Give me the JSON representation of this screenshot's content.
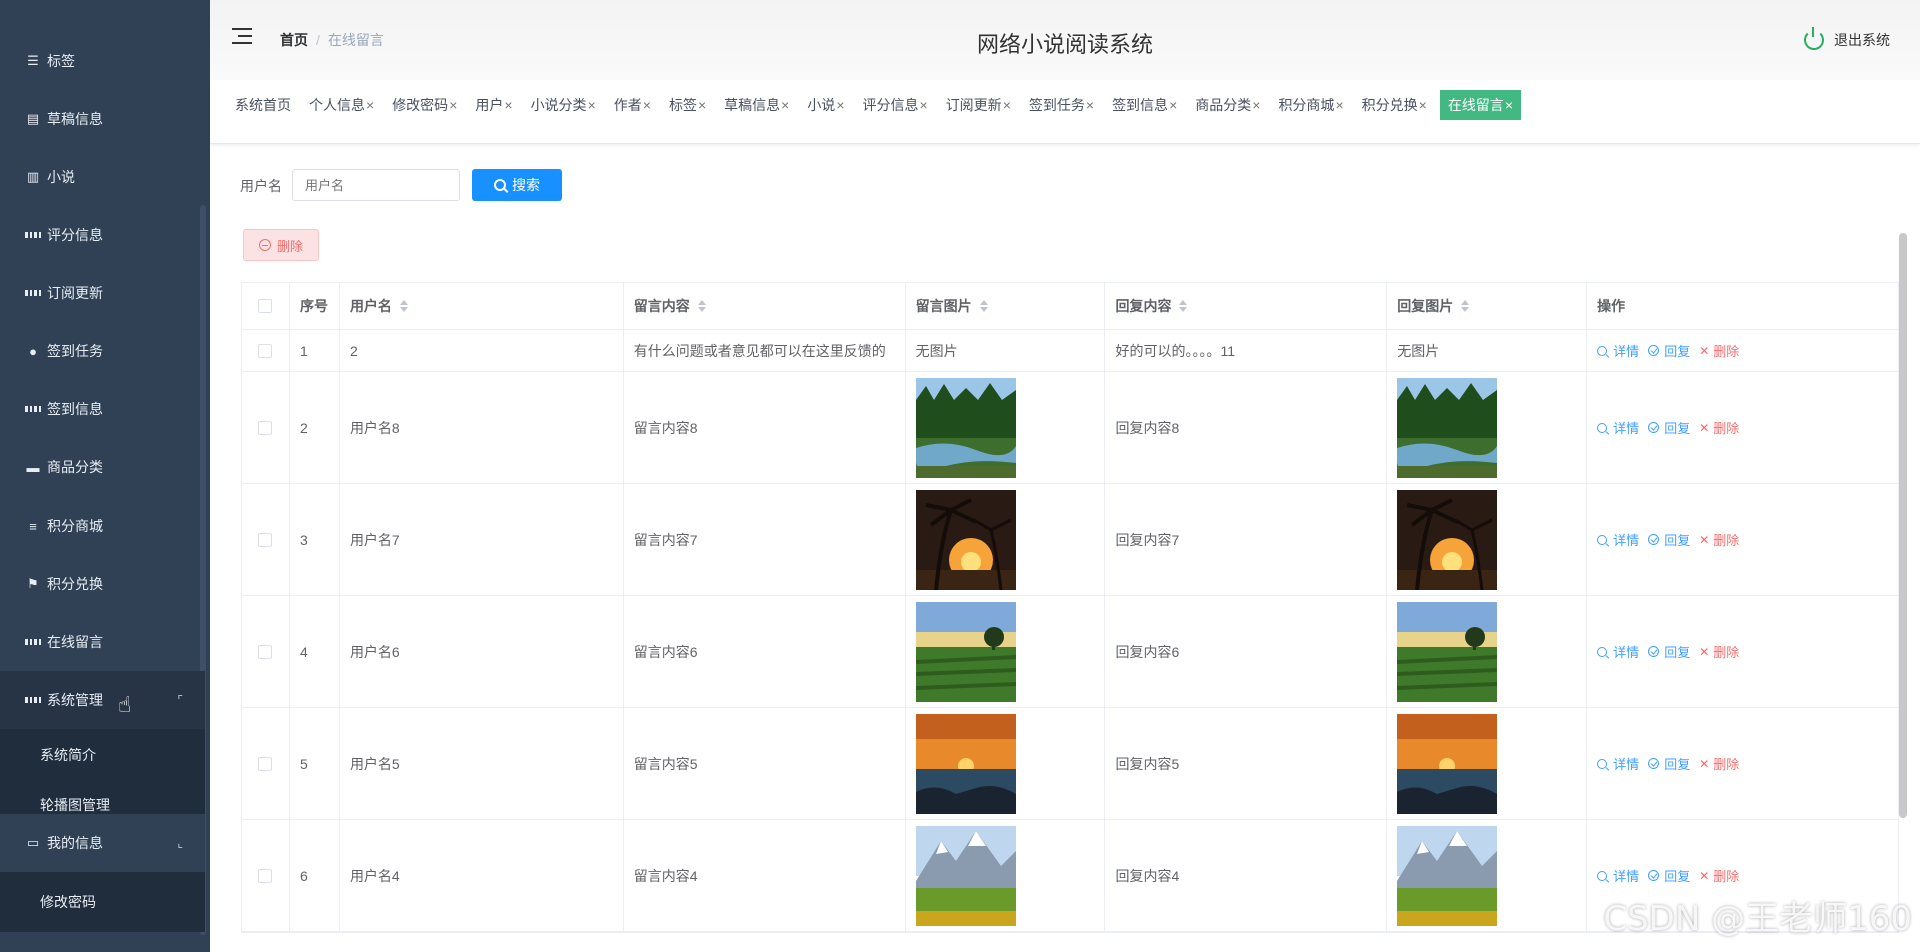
{
  "app": {
    "title": "网络小说阅读系统",
    "logout_label": "退出系统"
  },
  "breadcrumb": {
    "home": "首页",
    "current": "在线留言"
  },
  "sidebar": {
    "items": [
      {
        "label": "标签",
        "icon": "sliders-icon"
      },
      {
        "label": "草稿信息",
        "icon": "clipboard-icon"
      },
      {
        "label": "小说",
        "icon": "books-icon"
      },
      {
        "label": "评分信息",
        "icon": "grid-icon"
      },
      {
        "label": "订阅更新",
        "icon": "grid-icon"
      },
      {
        "label": "签到任务",
        "icon": "user-icon"
      },
      {
        "label": "签到信息",
        "icon": "grid-icon"
      },
      {
        "label": "商品分类",
        "icon": "message-icon"
      },
      {
        "label": "积分商城",
        "icon": "list-icon"
      },
      {
        "label": "积分兑换",
        "icon": "flag-icon"
      },
      {
        "label": "在线留言",
        "icon": "grid-icon"
      },
      {
        "label": "系统管理",
        "icon": "grid-icon"
      },
      {
        "label": "系统简介"
      },
      {
        "label": "轮播图管理"
      },
      {
        "label": "我的信息",
        "icon": "card-icon"
      },
      {
        "label": "修改密码"
      }
    ]
  },
  "tags": [
    {
      "label": "系统首页",
      "closable": false
    },
    {
      "label": "个人信息",
      "closable": true
    },
    {
      "label": "修改密码",
      "closable": true
    },
    {
      "label": "用户",
      "closable": true
    },
    {
      "label": "小说分类",
      "closable": true
    },
    {
      "label": "作者",
      "closable": true
    },
    {
      "label": "标签",
      "closable": true
    },
    {
      "label": "草稿信息",
      "closable": true
    },
    {
      "label": "小说",
      "closable": true
    },
    {
      "label": "评分信息",
      "closable": true
    },
    {
      "label": "订阅更新",
      "closable": true
    },
    {
      "label": "签到任务",
      "closable": true
    },
    {
      "label": "签到信息",
      "closable": true
    },
    {
      "label": "商品分类",
      "closable": true
    },
    {
      "label": "积分商城",
      "closable": true
    },
    {
      "label": "积分兑换",
      "closable": true
    },
    {
      "label": "在线留言",
      "closable": true,
      "active": true
    }
  ],
  "close_glyph": "×",
  "search": {
    "label": "用户名",
    "placeholder": "用户名",
    "button": "搜索"
  },
  "toolbar": {
    "delete_label": "删除"
  },
  "table": {
    "columns": [
      "序号",
      "用户名",
      "留言内容",
      "留言图片",
      "回复内容",
      "回复图片",
      "操作"
    ],
    "no_image_text": "无图片",
    "actions": {
      "detail": "详情",
      "reply": "回复",
      "delete": "删除"
    },
    "rows": [
      {
        "index": "1",
        "username": "2",
        "content": "有什么问题或者意见都可以在这里反馈的",
        "image": "none",
        "reply": "好的可以的。。。。11",
        "reply_image": "none"
      },
      {
        "index": "2",
        "username": "用户名8",
        "content": "留言内容8",
        "image": "forest-river",
        "reply": "回复内容8",
        "reply_image": "forest-river"
      },
      {
        "index": "3",
        "username": "用户名7",
        "content": "留言内容7",
        "image": "palm-sunset",
        "reply": "回复内容7",
        "reply_image": "palm-sunset"
      },
      {
        "index": "4",
        "username": "用户名6",
        "content": "留言内容6",
        "image": "tea-field",
        "reply": "回复内容6",
        "reply_image": "tea-field"
      },
      {
        "index": "5",
        "username": "用户名5",
        "content": "留言内容5",
        "image": "sea-sunset",
        "reply": "回复内容5",
        "reply_image": "sea-sunset"
      },
      {
        "index": "6",
        "username": "用户名4",
        "content": "留言内容4",
        "image": "mountain-meadow",
        "reply": "回复内容4",
        "reply_image": "mountain-meadow"
      }
    ]
  },
  "watermark": "CSDN @王老师160",
  "colors": {
    "sidebar_bg": "#304156",
    "active_tag": "#42b983",
    "primary": "#1890ff",
    "danger": "#f56c6c"
  }
}
